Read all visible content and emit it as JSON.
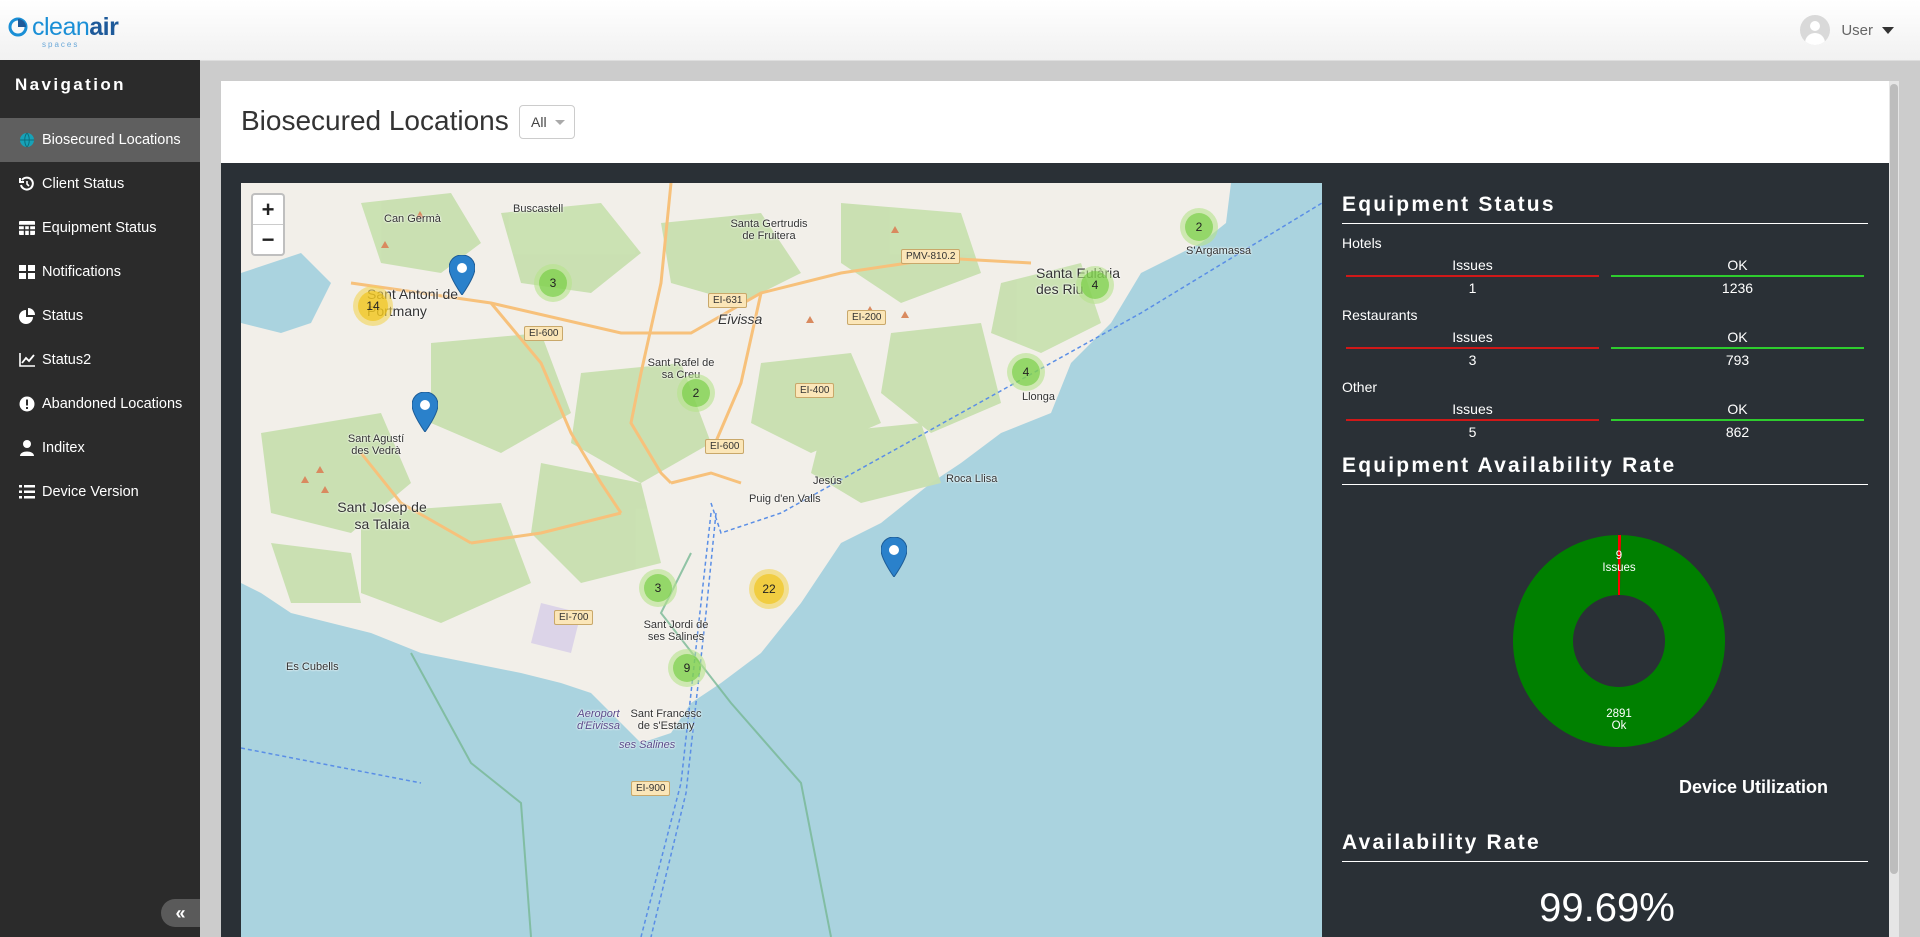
{
  "brand": {
    "name_part1": "clean",
    "name_part2": "air",
    "sub": "spaces"
  },
  "user": {
    "name": "User"
  },
  "sidebar": {
    "title": "Navigation",
    "items": [
      {
        "label": "Biosecured Locations",
        "icon": "globe-icon",
        "active": true
      },
      {
        "label": "Client Status",
        "icon": "history-icon"
      },
      {
        "label": "Equipment Status",
        "icon": "table-icon"
      },
      {
        "label": "Notifications",
        "icon": "grid-icon"
      },
      {
        "label": "Status",
        "icon": "pie-chart-icon"
      },
      {
        "label": "Status2",
        "icon": "line-chart-icon"
      },
      {
        "label": "Abandoned Locations",
        "icon": "exclamation-icon"
      },
      {
        "label": "Inditex",
        "icon": "user-icon"
      },
      {
        "label": "Device Version",
        "icon": "list-icon"
      }
    ],
    "collapse_label": "«"
  },
  "page": {
    "title": "Biosecured Locations",
    "filter_value": "All"
  },
  "map": {
    "zoom_in": "+",
    "zoom_out": "−",
    "clusters": [
      {
        "count": "2",
        "color": "green"
      },
      {
        "count": "3",
        "color": "green"
      },
      {
        "count": "14",
        "color": "yellow"
      },
      {
        "count": "4",
        "color": "green"
      },
      {
        "count": "4",
        "color": "green"
      },
      {
        "count": "2",
        "color": "green"
      },
      {
        "count": "3",
        "color": "green"
      },
      {
        "count": "22",
        "color": "yellow"
      },
      {
        "count": "9",
        "color": "green"
      }
    ],
    "places": [
      "Can Germà",
      "Buscastell",
      "Santa Gertrudis de Fruitera",
      "Sant Antoni de Portmany",
      "Eivissa",
      "Sant Rafel de sa Creu",
      "Santa Eulària des Riu",
      "S'Argamassa",
      "Sant Agustí des Vedrà",
      "Llonga",
      "Jesús",
      "Roca Llisa",
      "Sant Josep de sa Talaia",
      "Puig d'en Valls",
      "Sant Jordi de ses Salines",
      "Es Cubells",
      "Sant Francesc de s'Estany",
      "Aeroport d'Eivissa",
      "ses Salines"
    ],
    "roads": [
      "PMV-810.2",
      "EI-631",
      "EI-200",
      "EI-600",
      "EI-400",
      "EI-600",
      "EI-700",
      "EI-900"
    ]
  },
  "equipment_status": {
    "title": "Equipment Status",
    "issues_label": "Issues",
    "ok_label": "OK",
    "categories": [
      {
        "name": "Hotels",
        "issues": "1",
        "ok": "1236"
      },
      {
        "name": "Restaurants",
        "issues": "3",
        "ok": "793"
      },
      {
        "name": "Other",
        "issues": "5",
        "ok": "862"
      }
    ]
  },
  "availability_chart": {
    "title": "Equipment Availability Rate",
    "footer": "Device Utilization",
    "issues_value": "9",
    "issues_label": "Issues",
    "ok_value": "2891",
    "ok_label": "Ok",
    "colors": {
      "ok": "#008000",
      "issues": "#ff0000"
    }
  },
  "chart_data": {
    "type": "pie",
    "categories": [
      "Issues",
      "Ok"
    ],
    "values": [
      9,
      2891
    ],
    "title": "Equipment Availability Rate"
  },
  "availability_rate": {
    "title": "Availability Rate",
    "value": "99.69%"
  }
}
